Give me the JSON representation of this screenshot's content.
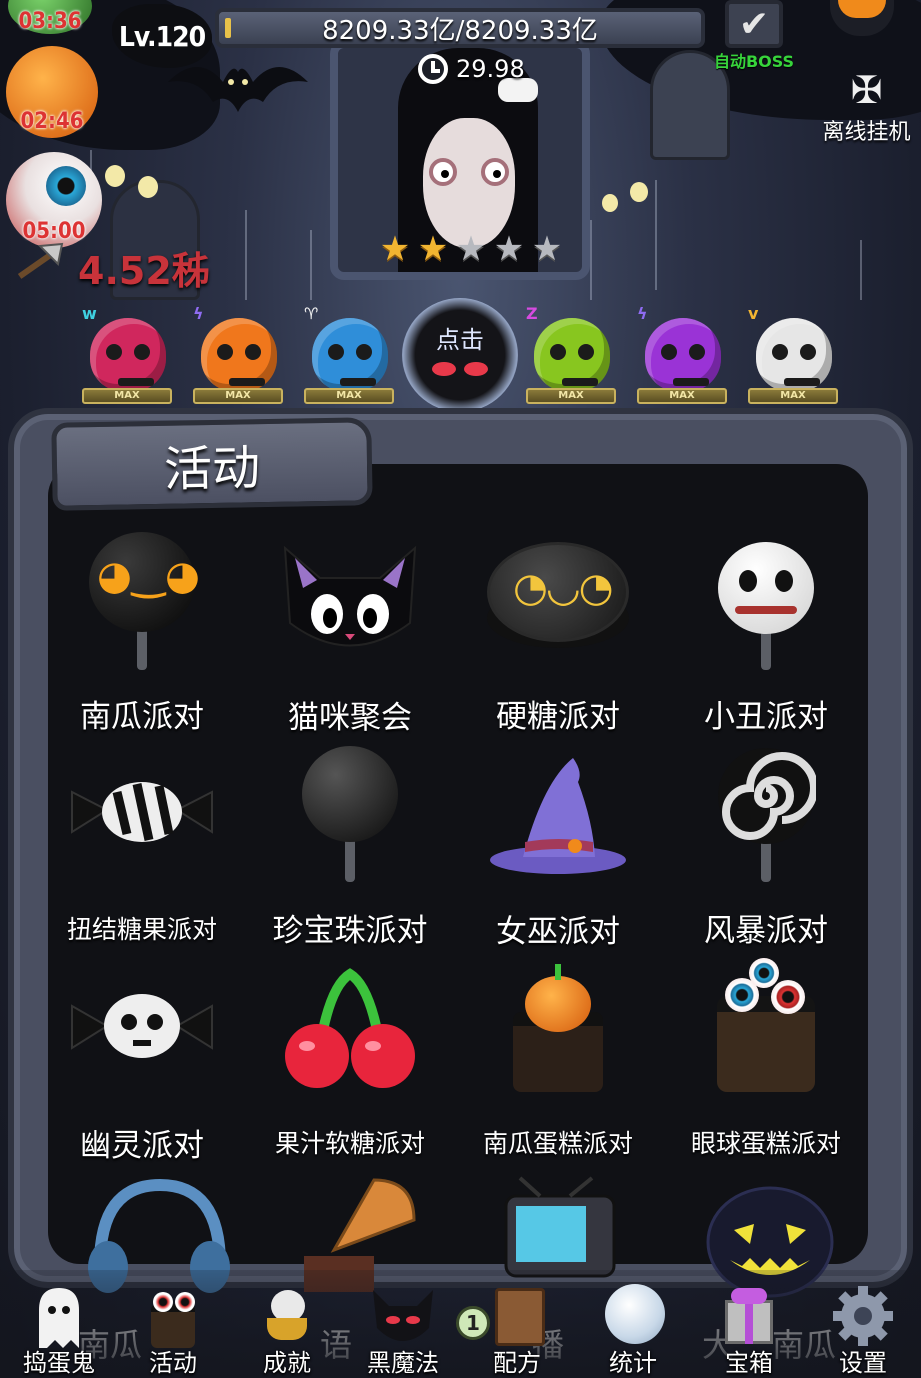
{
  "hud": {
    "level": "Lv.120",
    "boss_hp": "8209.33亿/8209.33亿",
    "boss_timer": "29.98",
    "stars_filled": 2,
    "stars_total": 5,
    "dps": "4.52秭",
    "auto_boss_label": "自动BOSS",
    "offline_label": "离线挂机",
    "side_timers": [
      "03:36",
      "02:46",
      "05:00"
    ]
  },
  "monsters": {
    "max_label": "MAX",
    "tap_label": "点击",
    "items": [
      {
        "color": "#d0275d",
        "mark": "w",
        "mark_color": "#3fd0e0"
      },
      {
        "color": "#f0771c",
        "mark": "ϟ",
        "mark_color": "#8f6cf2"
      },
      {
        "color": "#2f8ed9",
        "mark": "♈",
        "mark_color": "#f2f2f2"
      },
      {
        "color": "#88c61f",
        "mark": "Z",
        "mark_color": "#d64be0"
      },
      {
        "color": "#9a33d6",
        "mark": "ϟ",
        "mark_color": "#8f6cf2"
      },
      {
        "color": "#e6e6e6",
        "mark": "v",
        "mark_color": "#f2b531"
      }
    ]
  },
  "panel": {
    "title": "活动",
    "events": [
      {
        "label": "南瓜派对",
        "icon": "pumpkin-lollipop-icon"
      },
      {
        "label": "猫咪聚会",
        "icon": "black-cat-icon"
      },
      {
        "label": "硬糖派对",
        "icon": "hard-candy-icon"
      },
      {
        "label": "小丑派对",
        "icon": "clown-skull-lollipop-icon"
      },
      {
        "label": "扭结糖果派对",
        "icon": "wrapped-candy-icon"
      },
      {
        "label": "珍宝珠派对",
        "icon": "black-lollipop-icon"
      },
      {
        "label": "女巫派对",
        "icon": "witch-hat-icon"
      },
      {
        "label": "风暴派对",
        "icon": "swirl-lollipop-icon"
      },
      {
        "label": "幽灵派对",
        "icon": "skull-candy-icon"
      },
      {
        "label": "果汁软糖派对",
        "icon": "cherry-icon"
      },
      {
        "label": "南瓜蛋糕派对",
        "icon": "pumpkin-cake-icon"
      },
      {
        "label": "眼球蛋糕派对",
        "icon": "eyeball-cake-icon"
      }
    ],
    "partial_row": [
      "南瓜",
      "语",
      "播",
      "大",
      "南瓜"
    ]
  },
  "nav": {
    "items": [
      {
        "label": "捣蛋鬼",
        "icon": "ghost-icon"
      },
      {
        "label": "活动",
        "icon": "eyeball-cake-icon"
      },
      {
        "label": "成就",
        "icon": "skull-trophy-icon"
      },
      {
        "label": "黑魔法",
        "icon": "devil-icon"
      },
      {
        "label": "配方",
        "icon": "spellbook-icon"
      },
      {
        "label": "统计",
        "icon": "crystal-ball-icon"
      },
      {
        "label": "宝箱",
        "icon": "gift-box-icon"
      },
      {
        "label": "设置",
        "icon": "gear-icon"
      }
    ],
    "recipe_badge": "1"
  }
}
